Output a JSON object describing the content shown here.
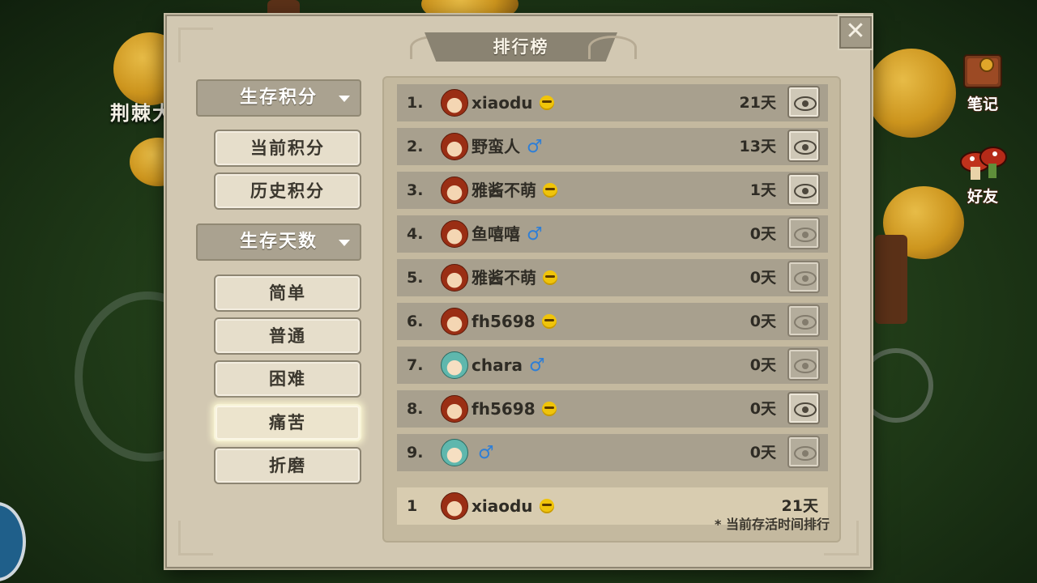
{
  "background": {
    "text": "荆棘大陆上有许多奇怪的"
  },
  "side_buttons": {
    "notes": {
      "label": "笔记",
      "icon": "book-icon"
    },
    "friends": {
      "label": "好友",
      "icon": "mushroom-friends-icon"
    }
  },
  "dialog": {
    "title": "排行榜",
    "close_icon": "close-icon",
    "close_glyph": "✕"
  },
  "categories": [
    {
      "label": "生存积分",
      "options": [
        {
          "label": "当前积分"
        },
        {
          "label": "历史积分"
        }
      ]
    },
    {
      "label": "生存天数",
      "options": [
        {
          "label": "简单"
        },
        {
          "label": "普通"
        },
        {
          "label": "困难"
        },
        {
          "label": "痛苦",
          "selected": true
        },
        {
          "label": "折磨"
        }
      ]
    }
  ],
  "leaderboard": {
    "rows": [
      {
        "rank": "1.",
        "name": "xiaodu",
        "badge": "smile",
        "days": "21天",
        "view_enabled": true
      },
      {
        "rank": "2.",
        "name": "野蛮人",
        "badge": "male",
        "days": "13天",
        "view_enabled": true
      },
      {
        "rank": "3.",
        "name": "雅酱不萌",
        "badge": "smile",
        "days": "1天",
        "view_enabled": true
      },
      {
        "rank": "4.",
        "name": "鱼嘻嘻",
        "badge": "male",
        "days": "0天",
        "view_enabled": false
      },
      {
        "rank": "5.",
        "name": "雅酱不萌",
        "badge": "smile",
        "days": "0天",
        "view_enabled": false
      },
      {
        "rank": "6.",
        "name": "fh5698",
        "badge": "smile",
        "days": "0天",
        "view_enabled": false
      },
      {
        "rank": "7.",
        "name": "chara",
        "badge": "male",
        "days": "0天",
        "view_enabled": false,
        "avatar": "teal"
      },
      {
        "rank": "8.",
        "name": "fh5698",
        "badge": "smile",
        "days": "0天",
        "view_enabled": true
      },
      {
        "rank": "9.",
        "name": "",
        "badge": "male",
        "days": "0天",
        "view_enabled": false,
        "avatar": "teal"
      }
    ],
    "my_rank": {
      "rank": "1",
      "name": "xiaodu",
      "badge": "smile",
      "days": "21天"
    },
    "footnote": "* 当前存活时间排行",
    "male_glyph": "♂"
  }
}
